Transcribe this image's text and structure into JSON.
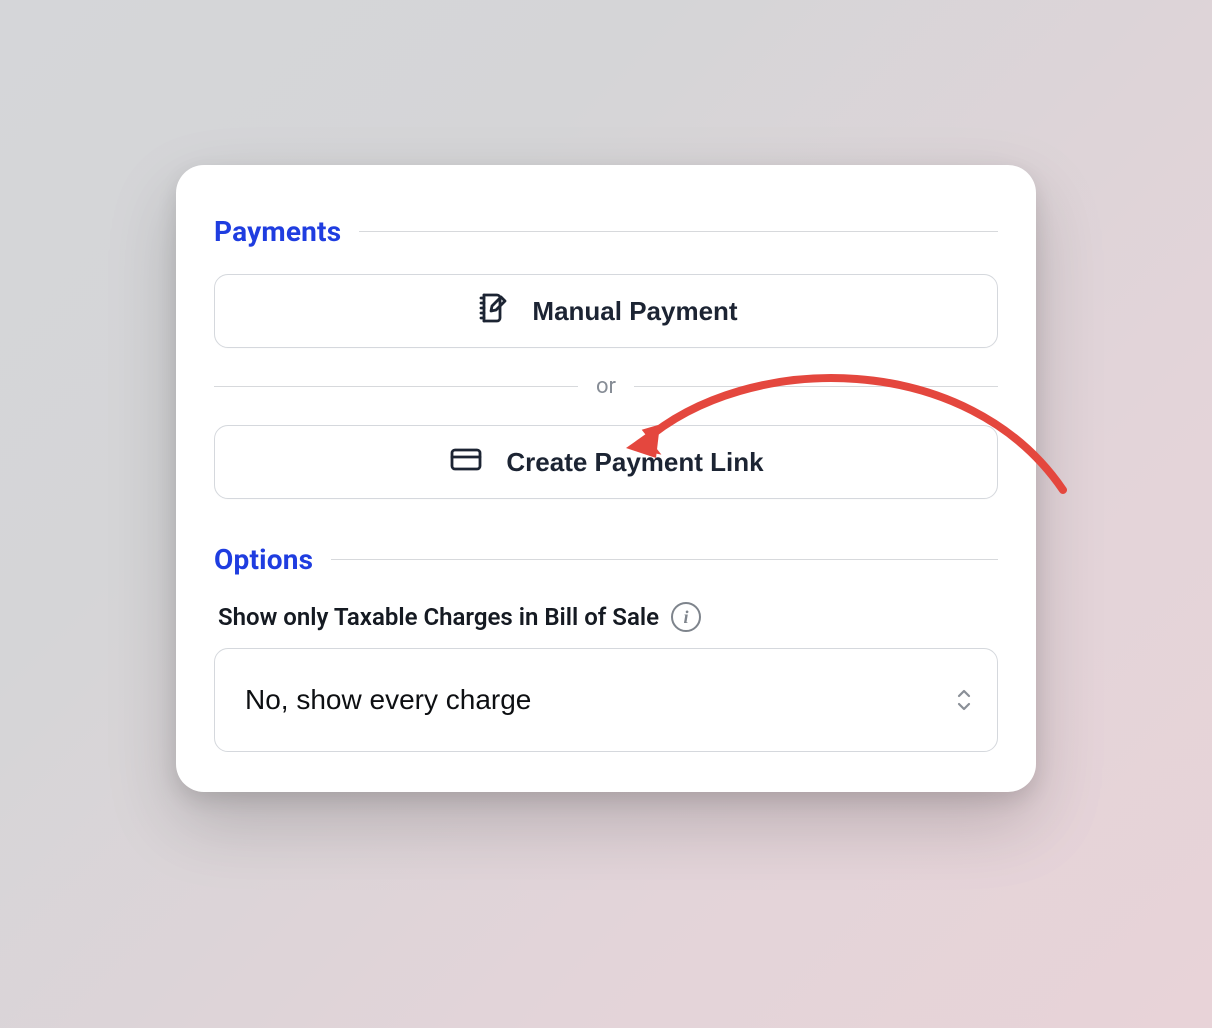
{
  "payments": {
    "title": "Payments",
    "manual_button_label": "Manual Payment",
    "or_label": "or",
    "create_link_button_label": "Create Payment Link"
  },
  "options": {
    "title": "Options",
    "taxable_label": "Show only Taxable Charges in Bill of Sale",
    "taxable_select_value": "No, show every charge"
  },
  "annotation": {
    "arrow_color": "#e4473e"
  }
}
